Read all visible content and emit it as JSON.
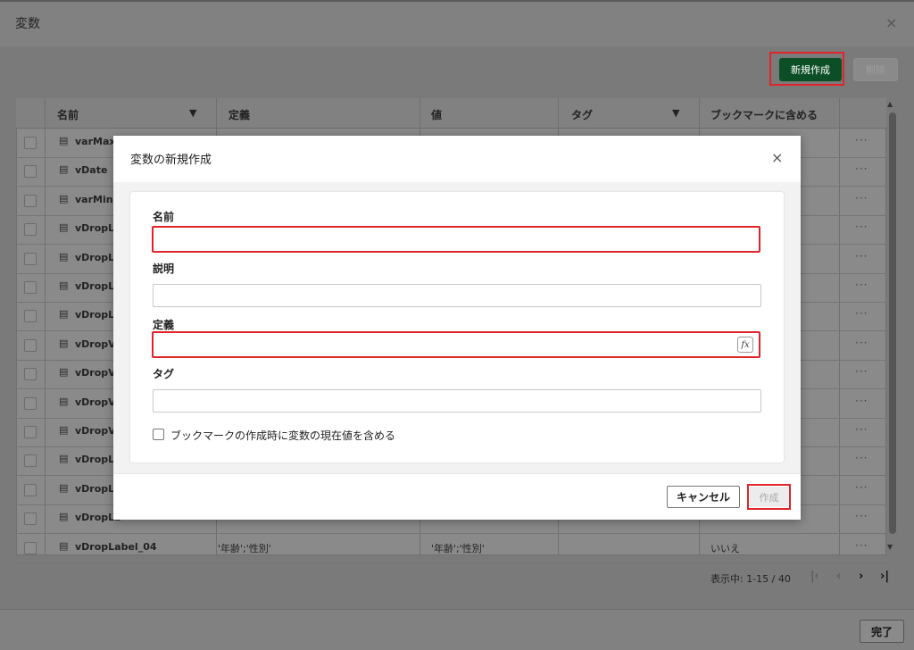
{
  "window": {
    "title": "変数",
    "close_icon": "×"
  },
  "toolbar": {
    "new_label": "新規作成",
    "delete_label": "削除"
  },
  "table": {
    "headers": {
      "checkbox": "",
      "name": "名前",
      "definition": "定義",
      "value": "値",
      "tag": "タグ",
      "bookmark": "ブックマークに含める"
    },
    "rows": [
      {
        "name": "varMaxD",
        "definition": "",
        "value": "",
        "bookmark": ""
      },
      {
        "name": "vDate",
        "definition": "",
        "value": "",
        "bookmark": ""
      },
      {
        "name": "varMinDa",
        "definition": "",
        "value": "",
        "bookmark": ""
      },
      {
        "name": "vDropLis",
        "definition": "",
        "value": "",
        "bookmark": ""
      },
      {
        "name": "vDropLis",
        "definition": "",
        "value": "",
        "bookmark": ""
      },
      {
        "name": "vDropLis",
        "definition": "",
        "value": "",
        "bookmark": ""
      },
      {
        "name": "vDropLis",
        "definition": "",
        "value": "",
        "bookmark": ""
      },
      {
        "name": "vDropVal",
        "definition": "",
        "value": "",
        "bookmark": ""
      },
      {
        "name": "vDropVal",
        "definition": "",
        "value": "",
        "bookmark": ""
      },
      {
        "name": "vDropVal",
        "definition": "",
        "value": "",
        "bookmark": ""
      },
      {
        "name": "vDropVal",
        "definition": "",
        "value": "",
        "bookmark": ""
      },
      {
        "name": "vDropLab",
        "definition": "",
        "value": "",
        "bookmark": ""
      },
      {
        "name": "vDropLab",
        "definition": "",
        "value": "",
        "bookmark": ""
      },
      {
        "name": "vDropLa",
        "definition": "",
        "value": "",
        "bookmark": ""
      },
      {
        "name": "vDropLabel_04",
        "definition": "'年齢';'性別'",
        "value": "'年齢';'性別'",
        "bookmark": "いいえ"
      }
    ],
    "more_icon": "···"
  },
  "pager": {
    "text": "表示中: 1-15 / 40",
    "first": "|‹",
    "prev": "‹",
    "next": "›",
    "last": "›|"
  },
  "footer": {
    "done_label": "完了"
  },
  "modal": {
    "title": "変数の新規作成",
    "close_icon": "×",
    "name_label": "名前",
    "name_value": "",
    "description_label": "説明",
    "description_value": "",
    "definition_label": "定義",
    "definition_value": "",
    "fx_icon": "fx",
    "tag_label": "タグ",
    "tag_value": "",
    "bookmark_checkbox_label": "ブックマークの作成時に変数の現在値を含める",
    "cancel_label": "キャンセル",
    "create_label": "作成"
  },
  "colors": {
    "highlight": "#e0252a",
    "primary_button": "#0c4e25"
  }
}
